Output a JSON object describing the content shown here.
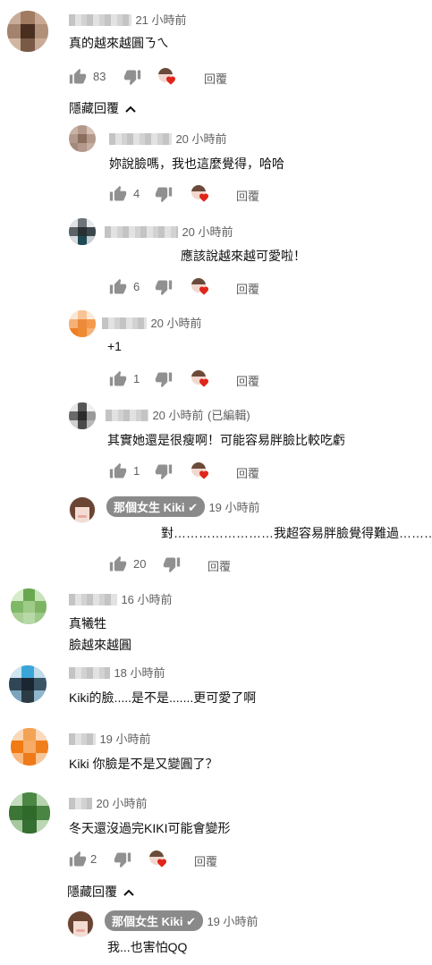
{
  "labels": {
    "reply": "回覆",
    "hide_replies": "隱藏回覆",
    "edited": "(已編輯)"
  },
  "comments": [
    {
      "time": "21 小時前",
      "text": "真的越來越圓ㄋㄟ",
      "likes": "83"
    },
    {
      "time": "20 小時前",
      "text": "妳說臉嗎，我也這麼覺得，哈哈",
      "likes": "4"
    },
    {
      "time": "20 小時前",
      "text": "應該說越來越可愛啦！",
      "likes": "6"
    },
    {
      "time": "20 小時前",
      "text": "+1",
      "likes": "1"
    },
    {
      "time": "20 小時前",
      "text": "其實她還是很瘦啊！可能容易胖臉比較吃虧",
      "likes": "1"
    },
    {
      "author": "那個女生 Kiki",
      "time": "19 小時前",
      "text": "對……………………我超容易胖臉覺得難過………",
      "likes": "20"
    },
    {
      "time": "16 小時前",
      "text_line1": "真犧牲",
      "text_line2": "臉越來越圓"
    },
    {
      "time": "18 小時前",
      "text": "Kiki的臉.....是不是.......更可愛了啊"
    },
    {
      "time": "19 小時前",
      "text": "Kiki 你臉是不是又變圓了？"
    },
    {
      "time": "20 小時前",
      "text": "冬天還沒過完KIKI可能會變形",
      "likes": "2"
    },
    {
      "author": "那個女生 Kiki",
      "time": "19 小時前",
      "text": "我...也害怕QQ"
    }
  ],
  "colors": {
    "chip_bg": "#8a8a8a",
    "heart": "#e1251b",
    "text": "#0f0f0f",
    "meta": "#606060"
  },
  "icons": [
    "thumbs-up-icon",
    "thumbs-down-icon",
    "creator-heart-icon",
    "chevron-up-icon",
    "check-icon"
  ]
}
